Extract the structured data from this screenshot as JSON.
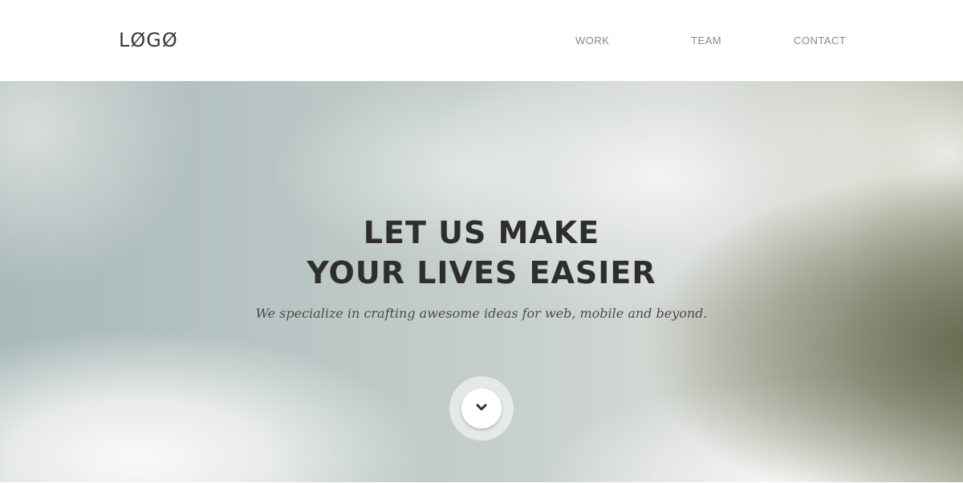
{
  "header": {
    "logo": "LØGØ",
    "nav": [
      {
        "label": "WORK"
      },
      {
        "label": "TEAM"
      },
      {
        "label": "CONTACT"
      }
    ]
  },
  "hero": {
    "title_line_1": "LET US MAKE",
    "title_line_2": "YOUR LIVES EASIER",
    "subtitle": "We specialize in crafting awesome ideas for web, mobile and beyond.",
    "scroll_icon": "chevron-down-icon"
  }
}
